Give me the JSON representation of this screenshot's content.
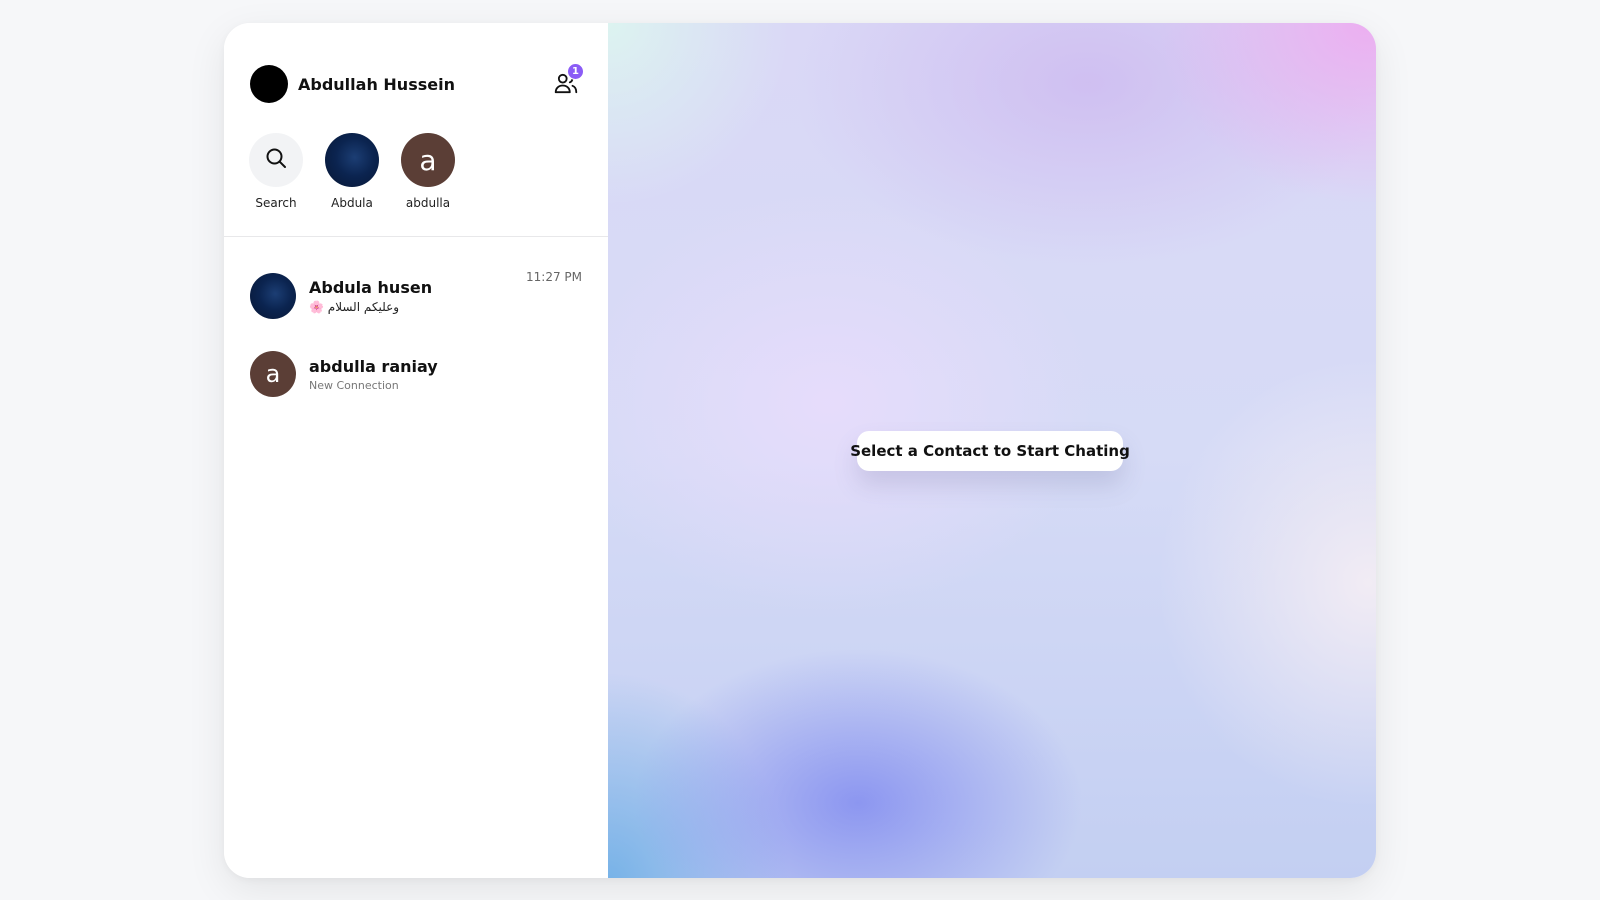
{
  "profile": {
    "name": "Abdullah Hussein",
    "avatar_icon": "moon-icon",
    "friend_requests_icon": "users-icon",
    "friend_requests_count": "1"
  },
  "stories": [
    {
      "label": "Search",
      "type": "search",
      "icon": "search-icon"
    },
    {
      "label": "Abdula",
      "type": "image",
      "icon": "moon-icon"
    },
    {
      "label": "abdulla",
      "type": "letter",
      "letter": "a"
    }
  ],
  "chats": [
    {
      "name": "Abdula husen",
      "preview": "🌸 وعليكم السلام",
      "time": "11:27 PM",
      "avatar_icon": "moon-icon"
    },
    {
      "name": "abdulla raniay",
      "preview": "New Connection",
      "time": "",
      "avatar_letter": "a"
    }
  ],
  "main": {
    "prompt": "Select a Contact to Start Chating"
  },
  "colors": {
    "badge": "#8b5cf6",
    "letter_avatar": "#5b3e36",
    "night_avatar": "#0b2450"
  }
}
